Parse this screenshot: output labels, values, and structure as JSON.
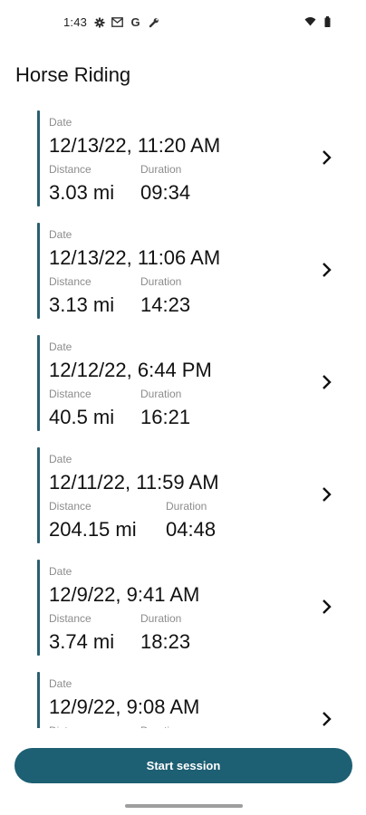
{
  "status_bar": {
    "time": "1:43",
    "left_icons": [
      "settings-icon",
      "mail-icon",
      "google-icon",
      "wrench-icon"
    ],
    "right_icons": [
      "wifi-icon",
      "battery-icon"
    ],
    "google_glyph": "G"
  },
  "page": {
    "title": "Horse Riding"
  },
  "labels": {
    "date": "Date",
    "distance": "Distance",
    "duration": "Duration"
  },
  "sessions": [
    {
      "date": "12/13/22, 11:20 AM",
      "distance": "3.03 mi",
      "duration": "09:34"
    },
    {
      "date": "12/13/22, 11:06 AM",
      "distance": "3.13 mi",
      "duration": "14:23"
    },
    {
      "date": "12/12/22, 6:44 PM",
      "distance": "40.5 mi",
      "duration": "16:21"
    },
    {
      "date": "12/11/22, 11:59 AM",
      "distance": "204.15 mi",
      "duration": "04:48"
    },
    {
      "date": "12/9/22, 9:41 AM",
      "distance": "3.74 mi",
      "duration": "18:23"
    },
    {
      "date": "12/9/22, 9:08 AM",
      "distance": "",
      "duration": ""
    }
  ],
  "actions": {
    "start_session": "Start session"
  },
  "colors": {
    "accent": "#1d5f73",
    "card_bar": "#2a5f70",
    "label": "#8c8c8c"
  }
}
